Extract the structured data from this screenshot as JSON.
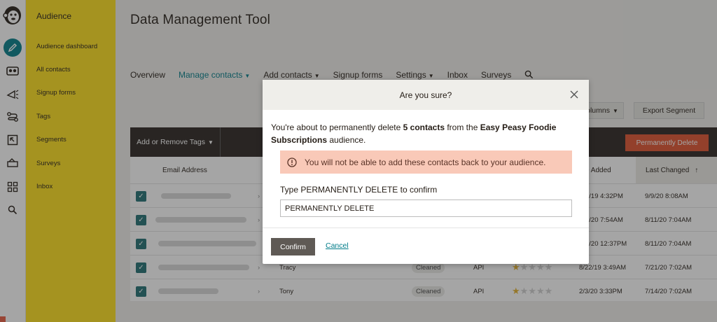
{
  "app": {
    "title": "Data Management Tool"
  },
  "sidebar": {
    "title": "Audience",
    "items": [
      {
        "label": "Audience dashboard"
      },
      {
        "label": "All contacts"
      },
      {
        "label": "Signup forms"
      },
      {
        "label": "Tags"
      },
      {
        "label": "Segments"
      },
      {
        "label": "Surveys"
      },
      {
        "label": "Inbox"
      }
    ]
  },
  "nav": {
    "overview": "Overview",
    "manage_contacts": "Manage contacts",
    "add_contacts": "Add contacts",
    "signup_forms": "Signup forms",
    "settings": "Settings",
    "inbox": "Inbox",
    "surveys": "Surveys"
  },
  "toolbar": {
    "columns_label": "olumns",
    "export_segment": "Export Segment",
    "add_remove_tags": "Add or Remove Tags",
    "permanently_delete": "Permanently Delete"
  },
  "table": {
    "headers": {
      "email": "Email Address",
      "date_added": "e Added",
      "last_changed": "Last Changed"
    },
    "rows": [
      {
        "name": "",
        "status": "",
        "source": "",
        "rating": 0,
        "date_added": "1/19 4:32PM",
        "last_changed": "9/9/20 8:08AM"
      },
      {
        "name": "",
        "status": "",
        "source": "",
        "rating": 0,
        "date_added": "0/20 7:54AM",
        "last_changed": "8/11/20 7:04AM"
      },
      {
        "name": "",
        "status": "",
        "source": "",
        "rating": 0,
        "date_added": "3/20 12:37PM",
        "last_changed": "8/11/20 7:04AM"
      },
      {
        "name": "Tracy",
        "status": "Cleaned",
        "source": "API",
        "rating": 1,
        "date_added": "8/22/19 3:49AM",
        "last_changed": "7/21/20 7:02AM"
      },
      {
        "name": "Tony",
        "status": "Cleaned",
        "source": "API",
        "rating": 1,
        "date_added": "2/3/20 3:33PM",
        "last_changed": "7/14/20 7:02AM"
      }
    ]
  },
  "modal": {
    "title": "Are you sure?",
    "msg_pre": "You're about to permanently delete ",
    "msg_count": "5 contacts",
    "msg_mid": " from the ",
    "msg_audience": "Easy Peasy Foodie Subscriptions",
    "msg_post": " audience.",
    "warning": "You will not be able to add these contacts back to your audience.",
    "confirm_label": "Type PERMANENTLY DELETE to confirm",
    "confirm_value": "PERMANENTLY DELETE",
    "confirm_button": "Confirm",
    "cancel_link": "Cancel"
  },
  "colors": {
    "brand_yellow": "#ffe01b",
    "accent_teal": "#007c89",
    "danger_orange": "#e0522d",
    "warning_bg": "#f9c9b8"
  }
}
